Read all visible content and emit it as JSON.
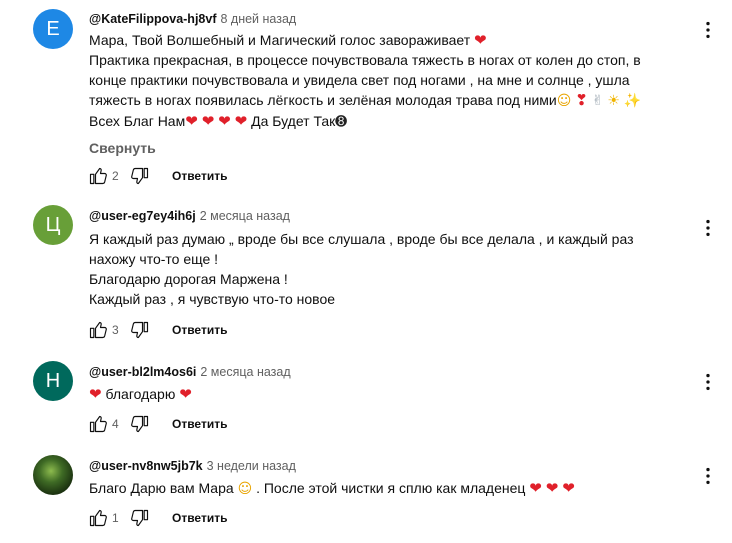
{
  "colors": {
    "avatar_e": "#1e88e5",
    "avatar_ts": "#689f38",
    "avatar_n": "#00695c",
    "heart": "#e0202a",
    "muted": "#606060"
  },
  "comments": [
    {
      "author": "@KateFilippova-hj8vf",
      "time": "8 дней назад",
      "avatar_letter": "Е",
      "lines": [
        "Мара, Твой Волшебный и Магический голос завораживает",
        "Практика прекрасная, в процессе почувствовала тяжесть в ногах от колен до стоп, в",
        "конце практики почувствовала и увидела свет под ногами , на мне и солнце , ушла",
        "тяжесть в ногах появилась лёгкость и зелёная молодая трава под ними",
        "Всех Благ Нам",
        "Да Будет Так"
      ],
      "collapse_label": "Свернуть",
      "likes": "2",
      "reply_label": "Ответить"
    },
    {
      "author": "@user-eg7ey4ih6j",
      "time": "2 месяца назад",
      "avatar_letter": "Ц",
      "lines": [
        "Я каждый раз думаю „ вроде бы все слушала , вроде бы все делала , и каждый раз",
        "нахожу что-то еще !",
        "Благодарю дорогая Маржена !",
        "Каждый раз , я чувствую что-то новое"
      ],
      "likes": "3",
      "reply_label": "Ответить"
    },
    {
      "author": "@user-bl2lm4os6i",
      "time": "2 месяца назад",
      "avatar_letter": "Н",
      "lines": [
        "благодарю"
      ],
      "likes": "4",
      "reply_label": "Ответить"
    },
    {
      "author": "@user-nv8nw5jb7k",
      "time": "3 недели назад",
      "lines": [
        "Благо Дарю вам Мара",
        ". После этой чистки я сплю как младенец"
      ],
      "likes": "1",
      "reply_label": "Ответить"
    }
  ],
  "icons": {
    "like": "thumb-up-icon",
    "dislike": "thumb-down-icon",
    "menu": "more-vert-icon",
    "heart": "red-heart-emoji",
    "smile": "smiling-face-emoji",
    "love": "smiling-face-with-hearts-emoji",
    "dove": "dove-emoji",
    "sun": "sun-with-face-emoji",
    "sparkles": "sparkles-emoji",
    "ball": "8-ball-emoji"
  }
}
